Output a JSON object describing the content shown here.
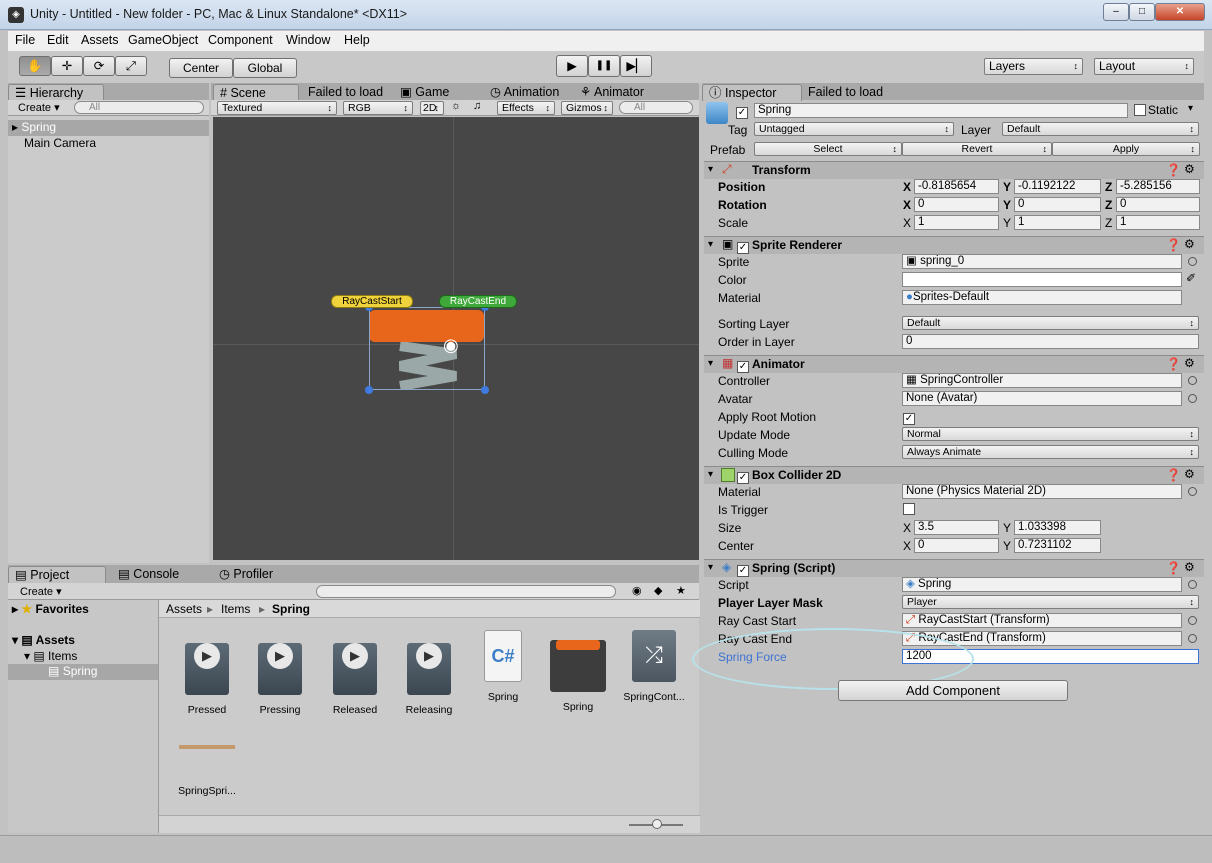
{
  "window": {
    "title": "Unity - Untitled - New folder - PC, Mac & Linux Standalone* <DX11>",
    "min": "‒",
    "max": "□",
    "close": "✕"
  },
  "menu": [
    "File",
    "Edit",
    "Assets",
    "GameObject",
    "Component",
    "Window",
    "Help"
  ],
  "toolbar": {
    "hand": "✋",
    "move": "✛",
    "rotate": "⟳",
    "scale": "⤢",
    "center": "Center",
    "global": "Global",
    "play": "▶",
    "pause": "❚❚",
    "step": "▶▏",
    "layers": "Layers",
    "layout": "Layout"
  },
  "hierarchy": {
    "tab": "Hierarchy",
    "create": "Create",
    "search": "All",
    "items": [
      "Spring",
      "Main Camera"
    ]
  },
  "scene": {
    "tabs": [
      "Scene",
      "Failed to load",
      "Game",
      "Animation",
      "Animator"
    ],
    "render": "Textured",
    "color": "RGB",
    "mode2d": "2D",
    "effects": "Effects",
    "gizmos": "Gizmos",
    "search": "All",
    "labels": [
      "RayCastStart",
      "RayCastEnd"
    ]
  },
  "project": {
    "tabs": [
      "Project",
      "Console",
      "Profiler"
    ],
    "create": "Create",
    "favorites": "Favorites",
    "assets": "Assets",
    "items": "Items",
    "spring": "Spring",
    "breadcrumb": [
      "Assets",
      "Items",
      "Spring"
    ],
    "files": [
      "Pressed",
      "Pressing",
      "Released",
      "Releasing",
      "Spring",
      "Spring",
      "SpringCont...",
      "SpringSpri..."
    ]
  },
  "inspector": {
    "tabs": [
      "Inspector",
      "Failed to load"
    ],
    "name": "Spring",
    "static": "Static",
    "tag_label": "Tag",
    "tag": "Untagged",
    "layer_label": "Layer",
    "layer": "Default",
    "prefab": "Prefab",
    "select": "Select",
    "revert": "Revert",
    "apply": "Apply",
    "transform": {
      "title": "Transform",
      "position": "Position",
      "rotation": "Rotation",
      "scale": "Scale",
      "pos": [
        "-0.8185654",
        "-0.1192122",
        "-5.285156"
      ],
      "rot": [
        "0",
        "0",
        "0"
      ],
      "scl": [
        "1",
        "1",
        "1"
      ],
      "axes": [
        "X",
        "Y",
        "Z"
      ]
    },
    "sprite_renderer": {
      "title": "Sprite Renderer",
      "sprite_l": "Sprite",
      "sprite": "spring_0",
      "color_l": "Color",
      "material_l": "Material",
      "material": "Sprites-Default",
      "sorting_l": "Sorting Layer",
      "sorting": "Default",
      "order_l": "Order in Layer",
      "order": "0"
    },
    "animator": {
      "title": "Animator",
      "controller_l": "Controller",
      "controller": "SpringController",
      "avatar_l": "Avatar",
      "avatar": "None (Avatar)",
      "root_l": "Apply Root Motion",
      "update_l": "Update Mode",
      "update": "Normal",
      "culling_l": "Culling Mode",
      "culling": "Always Animate"
    },
    "box_collider": {
      "title": "Box Collider 2D",
      "material_l": "Material",
      "material": "None (Physics Material 2D)",
      "trigger_l": "Is Trigger",
      "size_l": "Size",
      "size": [
        "3.5",
        "1.033398"
      ],
      "center_l": "Center",
      "center": [
        "0",
        "0.7231102"
      ]
    },
    "script": {
      "title": "Spring (Script)",
      "script_l": "Script",
      "script": "Spring",
      "mask_l": "Player Layer Mask",
      "mask": "Player",
      "start_l": "Ray Cast Start",
      "start": "RayCastStart (Transform)",
      "end_l": "Ray Cast End",
      "end": "RayCastEnd (Transform)",
      "force_l": "Spring Force",
      "force": "1200"
    },
    "add_component": "Add Component"
  },
  "colors": {
    "accent": "#3e72d4",
    "orange": "#e8661c",
    "viewport": "#474747"
  }
}
